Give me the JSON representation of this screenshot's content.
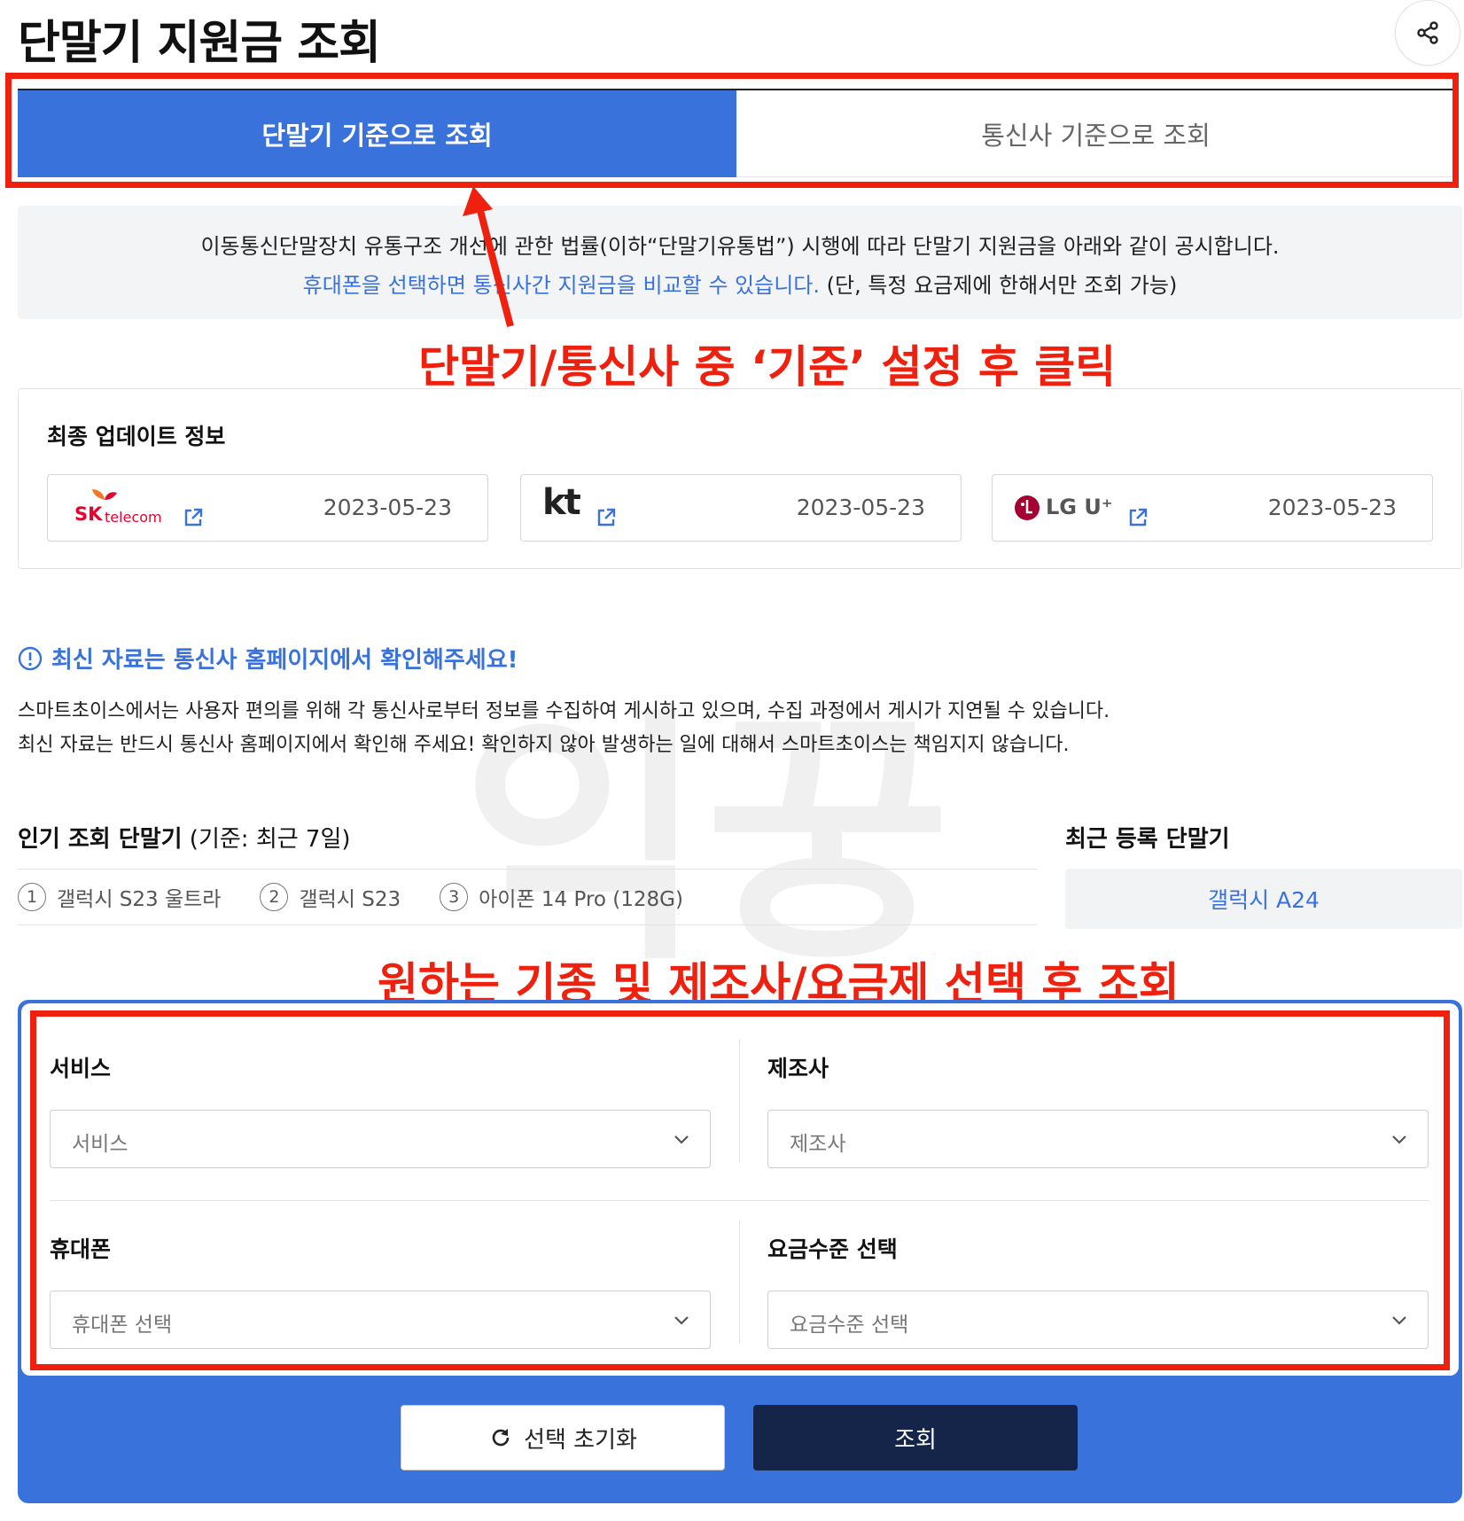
{
  "page": {
    "title": "단말기 지원금 조회"
  },
  "tabs": [
    {
      "label": "단말기 기준으로 조회"
    },
    {
      "label": "통신사 기준으로 조회"
    }
  ],
  "notice": {
    "line1": "이동통신단말장치 유통구조 개선에 관한 법률(이하“단말기유통법”) 시행에 따라 단말기 지원금을 아래와 같이 공시합니다.",
    "line2_blue": "휴대폰을 선택하면 통신사간 지원금을 비교할 수 있습니다.",
    "line2_rest": " (단, 특정 요금제에 한해서만 조회 가능)"
  },
  "annotations": {
    "top": "단말기/통신사 중 ‘기준’ 설정 후 클릭",
    "middle": "원하는 기종 및 제조사/요금제 선택 후 조회",
    "watermark": "익꿍"
  },
  "update": {
    "title": "최종 업데이트 정보",
    "carriers": [
      {
        "logo_main": "SK",
        "logo_sub": "telecom",
        "date": "2023-05-23"
      },
      {
        "logo_main": "kt",
        "date": "2023-05-23"
      },
      {
        "logo_main": "LG U⁺",
        "date": "2023-05-23"
      }
    ]
  },
  "info": {
    "title": "최신 자료는 통신사 홈페이지에서 확인해주세요!",
    "line1": "스마트초이스에서는 사용자 편의를 위해 각 통신사로부터 정보를 수집하여 게시하고 있으며, 수집 과정에서 게시가 지연될 수 있습니다.",
    "line2": "최신 자료는 반드시 통신사 홈페이지에서 확인해 주세요! 확인하지 않아 발생하는 일에 대해서 스마트초이스는 책임지지 않습니다."
  },
  "popular": {
    "title": "인기 조회 단말기",
    "subtitle": " (기준: 최근 7일)",
    "items": [
      {
        "num": "1",
        "label": "갤럭시 S23 울트라"
      },
      {
        "num": "2",
        "label": "갤럭시 S23"
      },
      {
        "num": "3",
        "label": "아이폰 14 Pro (128G)"
      }
    ]
  },
  "recent": {
    "title": "최근 등록 단말기",
    "item": "갤럭시 A24"
  },
  "form": {
    "service": {
      "label": "서비스",
      "placeholder": "서비스"
    },
    "maker": {
      "label": "제조사",
      "placeholder": "제조사"
    },
    "phone": {
      "label": "휴대폰",
      "placeholder": "휴대폰 선택"
    },
    "plan": {
      "label": "요금수준 선택",
      "placeholder": "요금수준 선택"
    }
  },
  "buttons": {
    "reset": "선택 초기화",
    "search": "조회"
  },
  "colors": {
    "accent_blue": "#3a72dc",
    "annotation_red": "#f0200f",
    "navy": "#152449"
  }
}
